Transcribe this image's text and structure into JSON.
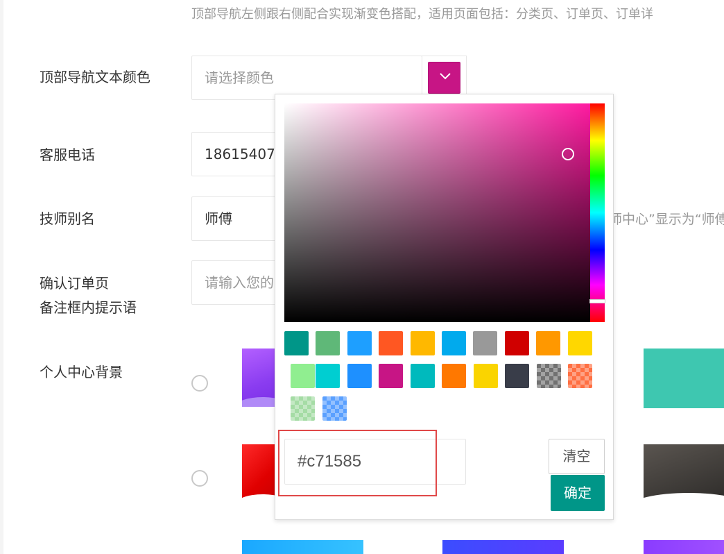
{
  "top_tip": "顶部导航左侧跟右侧配合实现渐变色搭配，适用页面包括：分类页、订单页、订单详",
  "rows": {
    "nav_text_color": {
      "label": "顶部导航文本颜色",
      "placeholder": "请选择颜色"
    },
    "service_phone": {
      "label": "客服电话",
      "value": "186154073"
    },
    "technician_alias": {
      "label": "技师别名",
      "value": "师傅",
      "tip": "师中心”显示为“师傅"
    },
    "order_remark": {
      "label_line1": "确认订单页",
      "label_line2": "备注框内提示语",
      "placeholder": "请输入您的"
    },
    "profile_bg": {
      "label": "个人中心背景"
    }
  },
  "color_picker": {
    "selected_color": "#c71585",
    "hex_value": "#c71585",
    "clear_label": "清空",
    "confirm_label": "确定",
    "swatches": [
      "#009688",
      "#5fb878",
      "#1e9fff",
      "#ff5722",
      "#ffb800",
      "#01aaed",
      "#999999",
      "#d00000",
      "#ff9800",
      "#ffd700",
      "#90ee90",
      "#00ced1",
      "#1e90ff",
      "#c71585",
      "#00babd",
      "#ff7800",
      "#fad400",
      "#393d49",
      "#717171",
      "#ff7043",
      "#a5dca5",
      "#5aa0ff"
    ]
  }
}
